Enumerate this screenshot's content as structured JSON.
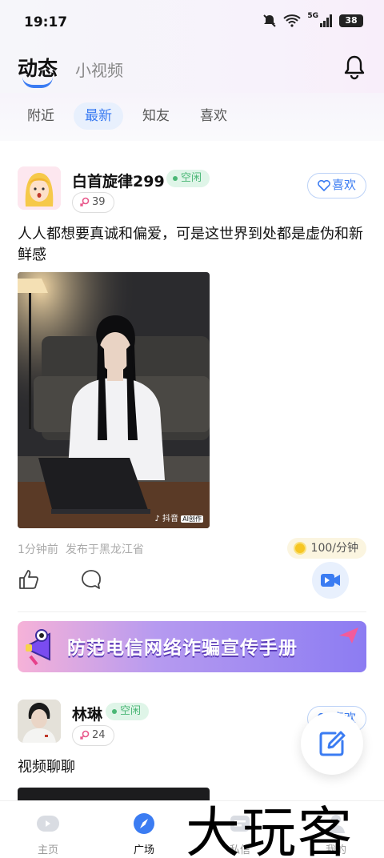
{
  "status_bar": {
    "time": "19:17",
    "battery": "38",
    "network": "5G"
  },
  "header": {
    "tab_active": "动态",
    "tab_other": "小视频"
  },
  "filters": [
    "附近",
    "最新",
    "知友",
    "喜欢"
  ],
  "posts": [
    {
      "username": "白首旋律299",
      "status": "空闲",
      "age": "39",
      "like_label": "喜欢",
      "text": "人人都想要真诚和偏爱，可是这世界到处都是虚伪和新鲜感",
      "image_watermark": "抖音",
      "image_watermark_tag": "AI创作",
      "time_ago": "1分钟前",
      "location": "发布于黑龙江省",
      "price": "100/分钟"
    },
    {
      "username": "林琳",
      "status": "空闲",
      "age": "24",
      "like_label": "喜欢",
      "text": "视频聊聊"
    }
  ],
  "banner": {
    "text": "防范电信网络诈骗宣传手册"
  },
  "tabbar": [
    "主页",
    "广场",
    "私信",
    "我的"
  ],
  "watermark": "大玩客",
  "colors": {
    "accent": "#3b7cf2",
    "status_green": "#4bb776",
    "banner_start": "#f6b2d8",
    "banner_end": "#8c7cf2"
  }
}
